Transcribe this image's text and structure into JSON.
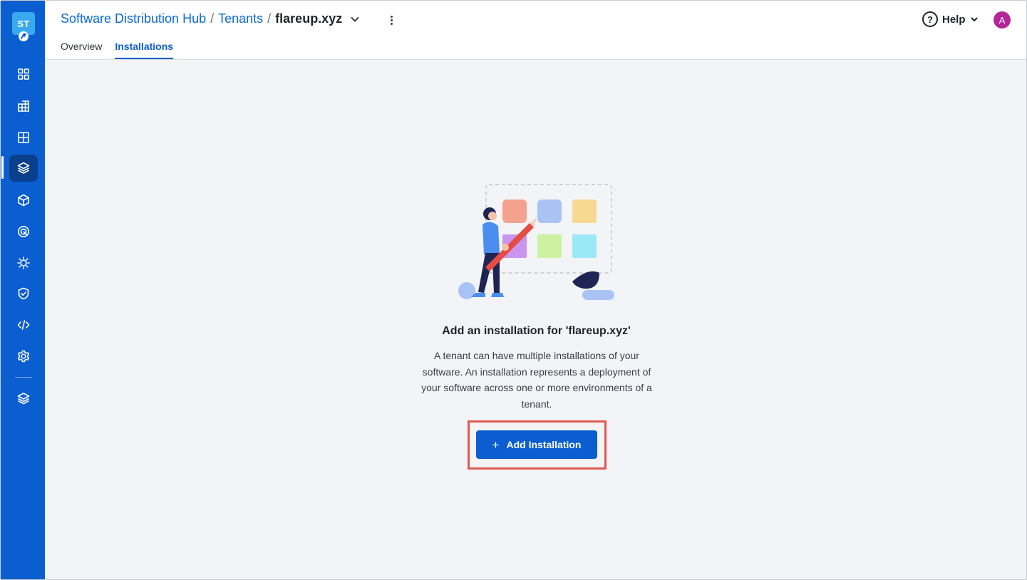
{
  "logo": {
    "text": "ST"
  },
  "sidebar": {
    "items": [
      {
        "icon": "dashboard-grid-icon",
        "active": false
      },
      {
        "icon": "table-grid-icon",
        "active": false
      },
      {
        "icon": "layout-grid-icon",
        "active": false
      },
      {
        "icon": "packages-icon",
        "active": true
      },
      {
        "icon": "cube-icon",
        "active": false
      },
      {
        "icon": "target-icon",
        "active": false
      },
      {
        "icon": "sun-gear-icon",
        "active": false
      },
      {
        "icon": "shield-check-icon",
        "active": false
      },
      {
        "icon": "code-icon",
        "active": false
      },
      {
        "icon": "settings-gear-icon",
        "active": false
      },
      {
        "icon": "layers-icon",
        "active": false
      }
    ]
  },
  "header": {
    "breadcrumb": {
      "root": "Software Distribution Hub",
      "section": "Tenants",
      "separator": "/",
      "current": "flareup.xyz"
    },
    "tabs": [
      {
        "label": "Overview",
        "active": false
      },
      {
        "label": "Installations",
        "active": true
      }
    ],
    "help": {
      "icon_glyph": "?",
      "label": "Help"
    },
    "avatar": {
      "initial": "A"
    }
  },
  "empty_state": {
    "title": "Add an installation for 'flareup.xyz'",
    "description": "A tenant can have multiple installations of your software. An installation represents a deployment of your software across one or more environments of a tenant.",
    "button": {
      "icon_glyph": "+",
      "label": "Add Installation"
    }
  },
  "colors": {
    "sidebar": "#0b5ed0",
    "sidebar_active": "#0a3f8c",
    "accent": "#0b5ed0",
    "link": "#0b6ad6",
    "highlight": "#e05a4f",
    "avatar": "#b52598"
  }
}
